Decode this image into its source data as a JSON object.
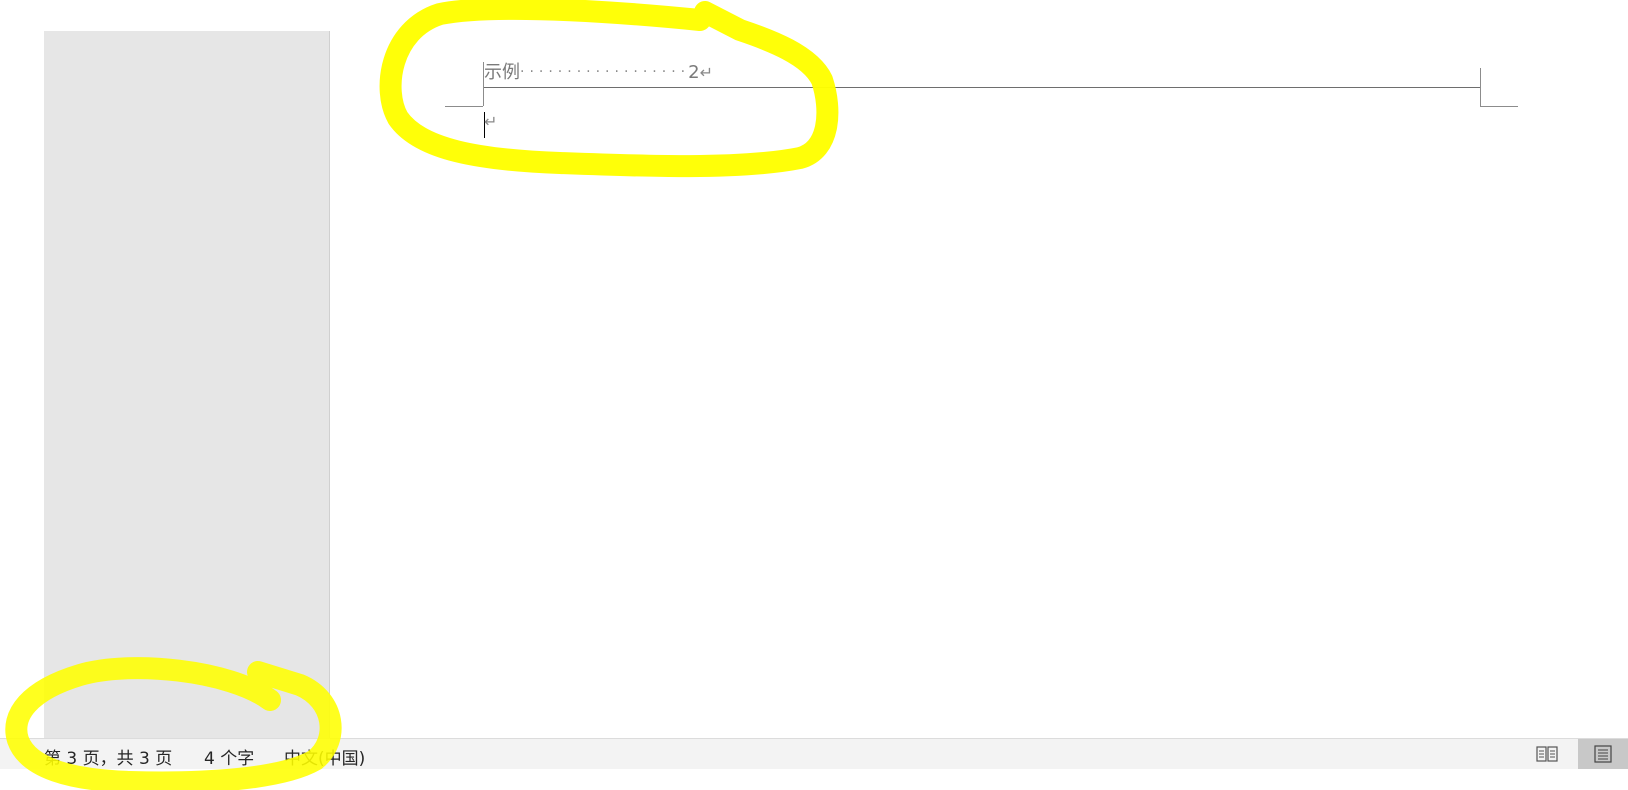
{
  "document": {
    "toc_entry": {
      "title": "示例",
      "leader": "··················",
      "page": "2",
      "para_mark": "↵"
    },
    "body_para_mark": "↵"
  },
  "status_bar": {
    "page_info": "第 3 页，共 3 页",
    "word_count": "4 个字",
    "language": "中文(中国)"
  },
  "view_buttons": [
    {
      "icon": "read-mode-icon",
      "active": false
    },
    {
      "icon": "print-layout-icon",
      "active": true
    }
  ],
  "colors": {
    "highlight": "#ffff00",
    "nav_pane": "#e6e6e6",
    "status_bar": "#f3f3f3"
  }
}
